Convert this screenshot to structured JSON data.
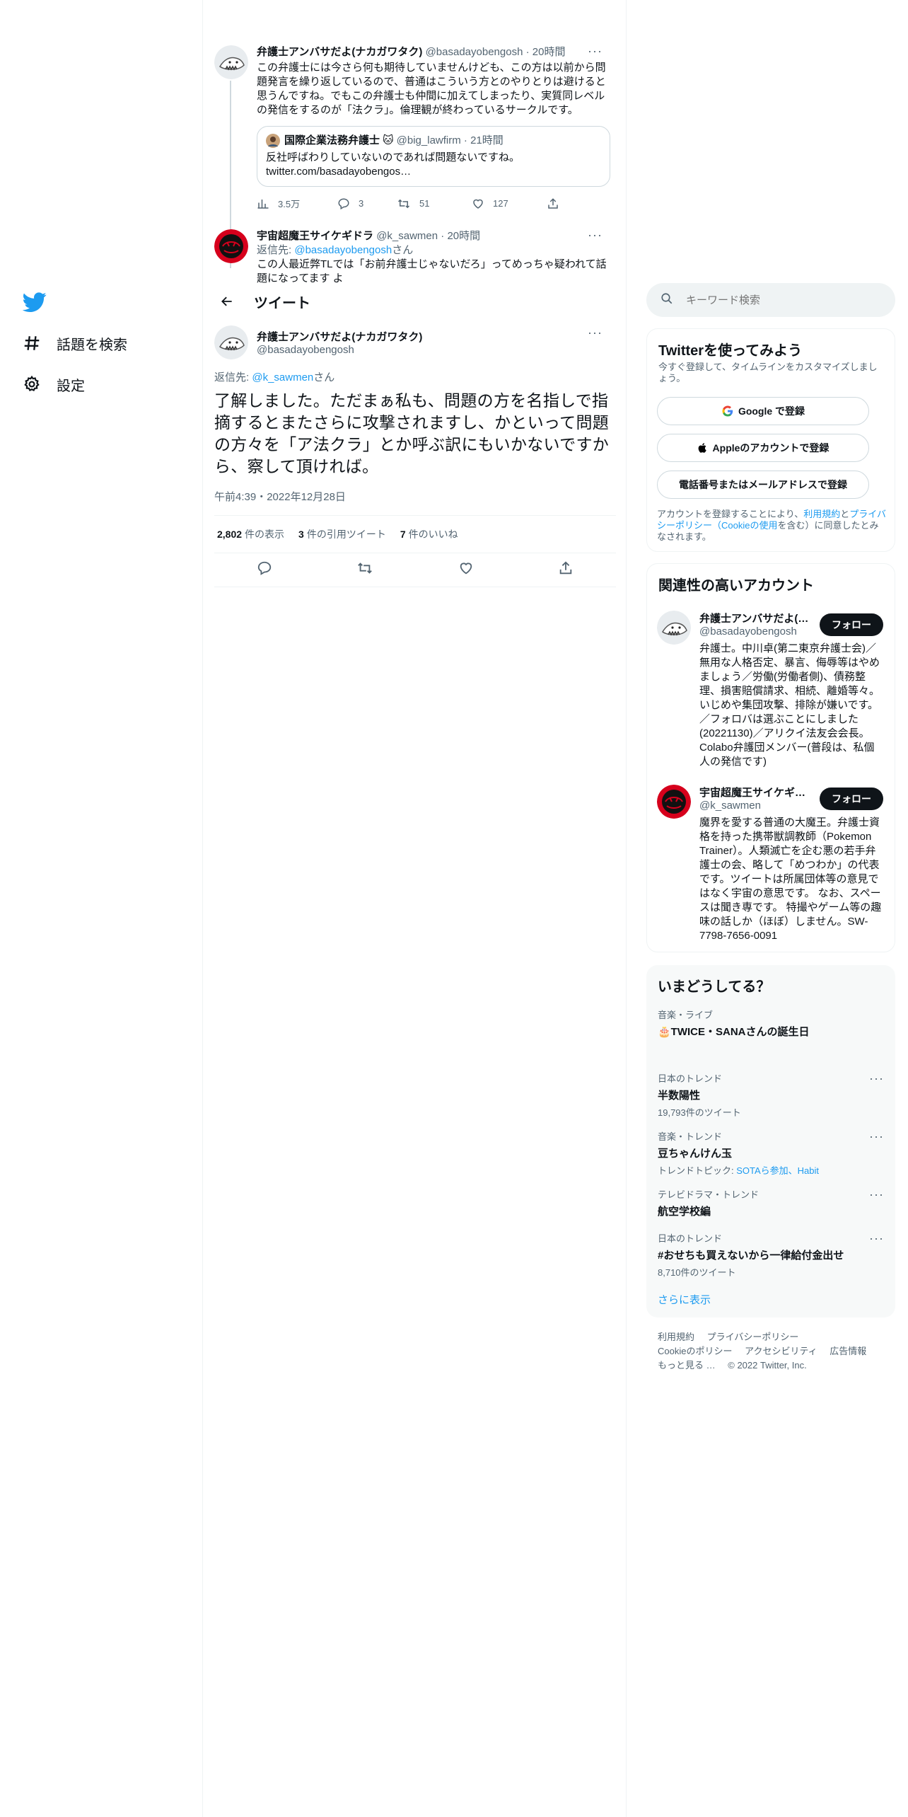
{
  "colors": {
    "brand": "#1d9bf0",
    "text": "#0f1419",
    "secondary": "#536471",
    "border": "#eff3f4"
  },
  "nav": {
    "logo_icon": "twitter-bird-icon",
    "items": [
      {
        "icon": "hashtag-icon",
        "label": "話題を検索"
      },
      {
        "icon": "gear-icon",
        "label": "設定"
      }
    ]
  },
  "thread": {
    "tweet1": {
      "name": "弁護士アンバサだよ(ナカガワタク)",
      "handle": "@basadayobengosh",
      "time": "20時間",
      "body": "この弁護士には今さら何も期待していませんけども、この方は以前から問題発言を繰り返しているので、普通はこういう方とのやりとりは避けると思うんですね。でもこの弁護士も仲間に加えてしまったり、実質同レベルの発信をするのが「法クラ」。倫理観が終わっているサークルです。",
      "quote": {
        "name": "国際企業法務弁護士",
        "handle": "@big_lawfirm",
        "time": "21時間",
        "text": "反社呼ばわりしていないのであれば問題ないですね。",
        "link": "twitter.com/basadayobengos…"
      },
      "views": "3.5万",
      "replies": "3",
      "retweets": "51",
      "likes": "127"
    },
    "tweet2": {
      "name": "宇宙超魔王サイケギドラ",
      "handle": "@k_sawmen",
      "time": "20時間",
      "reply_prefix": "返信先: ",
      "reply_to": "@basadayobengosh",
      "reply_suffix": "さん",
      "body": "この人最近弊TLでは「お前弁護士じゃないだろ」ってめっちゃ疑われて話題になってます よ"
    }
  },
  "header": {
    "title": "ツイート"
  },
  "focus": {
    "name": "弁護士アンバサだよ(ナカガワタク)",
    "handle": "@basadayobengosh",
    "reply_prefix": "返信先: ",
    "reply_to": "@k_sawmen",
    "reply_suffix": "さん",
    "body": "了解しました。ただまぁ私も、問題の方を名指しで指摘するとまたさらに攻撃されますし、かといって問題の方々を「ア法クラ」とか呼ぶ訳にもいかないですから、察して頂ければ。",
    "timestamp": "午前4:39・2022年12月28日",
    "views_num": "2,802",
    "views_label": "件の表示",
    "quotes_num": "3",
    "quotes_label": "件の引用ツイート",
    "likes_num": "7",
    "likes_label": "件のいいね"
  },
  "search": {
    "placeholder": "キーワード検索"
  },
  "signup": {
    "title": "Twitterを使ってみよう",
    "subtitle": "今すぐ登録して、タイムラインをカスタマイズしましょう。",
    "google": "Google で登録",
    "apple": "Appleのアカウントで登録",
    "phone": "電話番号またはメールアドレスで登録",
    "terms_1": "アカウントを登録することにより、",
    "terms_link1": "利用規約",
    "terms_2": "と",
    "terms_link2": "プライバシーポリシー（Cookieの使用",
    "terms_3": "を含む）に同意したとみなされます。"
  },
  "related": {
    "title": "関連性の高いアカウント",
    "follow_label": "フォロー",
    "accounts": [
      {
        "name": "弁護士アンバサだよ(…",
        "handle": "@basadayobengosh",
        "bio": "弁護士。中川卓(第二東京弁護士会)／無用な人格否定、暴言、侮辱等はやめましょう／労働(労働者側)、債務整理、損害賠償請求、相続、離婚等々。いじめや集団攻撃、排除が嫌いです。／フォロバは選ぶことにしました(20221130)／アリクイ法友会会長。Colabo弁護団メンバー(普段は、私個人の発信です)"
      },
      {
        "name": "宇宙超魔王サイケギ…",
        "handle": "@k_sawmen",
        "bio": "魔界を愛する普通の大魔王。弁護士資格を持った携帯獣調教師（Pokemon Trainer）。人類滅亡を企む悪の若手弁護士の会、略して「めつわか」の代表です。ツイートは所属団体等の意見ではなく宇宙の意思です。 なお、スペースは聞き専です。 特撮やゲーム等の趣味の話しか（ほぼ）しません。SW-7798-7656-0091"
      }
    ]
  },
  "trends": {
    "title": "いまどうしてる？",
    "items": [
      {
        "category": "音楽・ライブ",
        "title": "🎂TWICE・SANAさんの誕生日",
        "count": ""
      },
      {
        "category": "日本のトレンド",
        "title": "半数陽性",
        "count": "19,793件のツイート"
      },
      {
        "category": "音楽・トレンド",
        "title": "豆ちゃんけん玉",
        "count_prefix": "トレンドトピック: ",
        "count_link": "SOTAら参加、Habit"
      },
      {
        "category": "テレビドラマ・トレンド",
        "title": "航空学校編",
        "count": ""
      },
      {
        "category": "日本のトレンド",
        "title": "#おせちも買えないから一律給付金出せ",
        "count": "8,710件のツイート"
      }
    ],
    "show_more": "さらに表示"
  },
  "footer": {
    "links": [
      "利用規約",
      "プライバシーポリシー",
      "Cookieのポリシー",
      "アクセシビリティ",
      "広告情報",
      "もっと見る …"
    ],
    "copyright": "© 2022 Twitter, Inc."
  }
}
